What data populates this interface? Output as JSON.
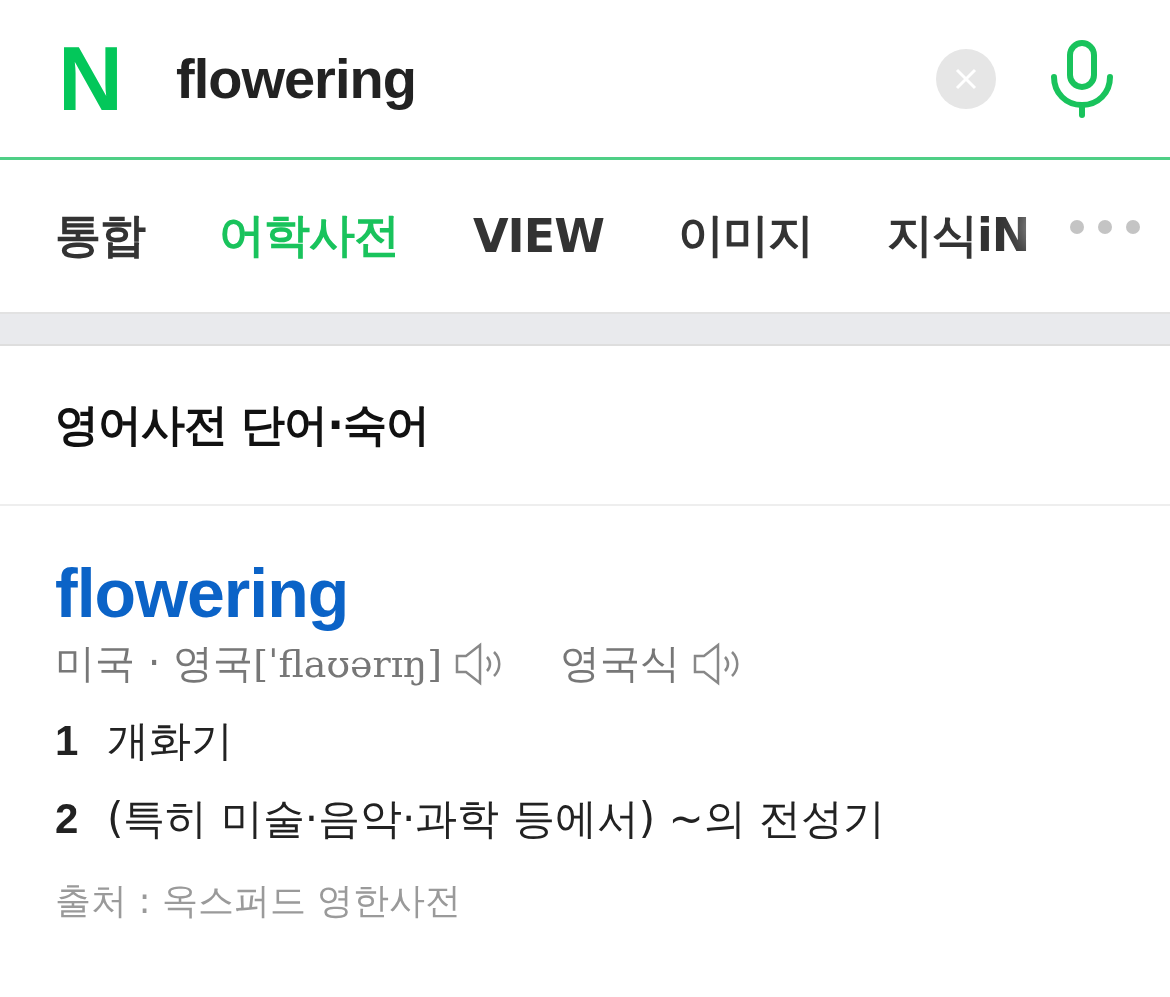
{
  "search": {
    "logo": "N",
    "query": "flowering"
  },
  "tabs": [
    {
      "label": "통합",
      "selected": false
    },
    {
      "label": "어학사전",
      "selected": true
    },
    {
      "label": "VIEW",
      "selected": false
    },
    {
      "label": "이미지",
      "selected": false
    },
    {
      "label": "지식iN",
      "selected": false
    }
  ],
  "section": {
    "title": "영어사전 단어·숙어"
  },
  "entry": {
    "word": "flowering",
    "pron_label": "미국 · 영국",
    "pron": "[ˈflaʊərɪŋ]",
    "alt_label": "영국식",
    "definitions": [
      {
        "number": "1",
        "text": "개화기"
      },
      {
        "number": "2",
        "text": "(특히 미술·음악·과학 등에서) ~의 전성기"
      }
    ],
    "source": "출처 : 옥스퍼드 영한사전"
  }
}
